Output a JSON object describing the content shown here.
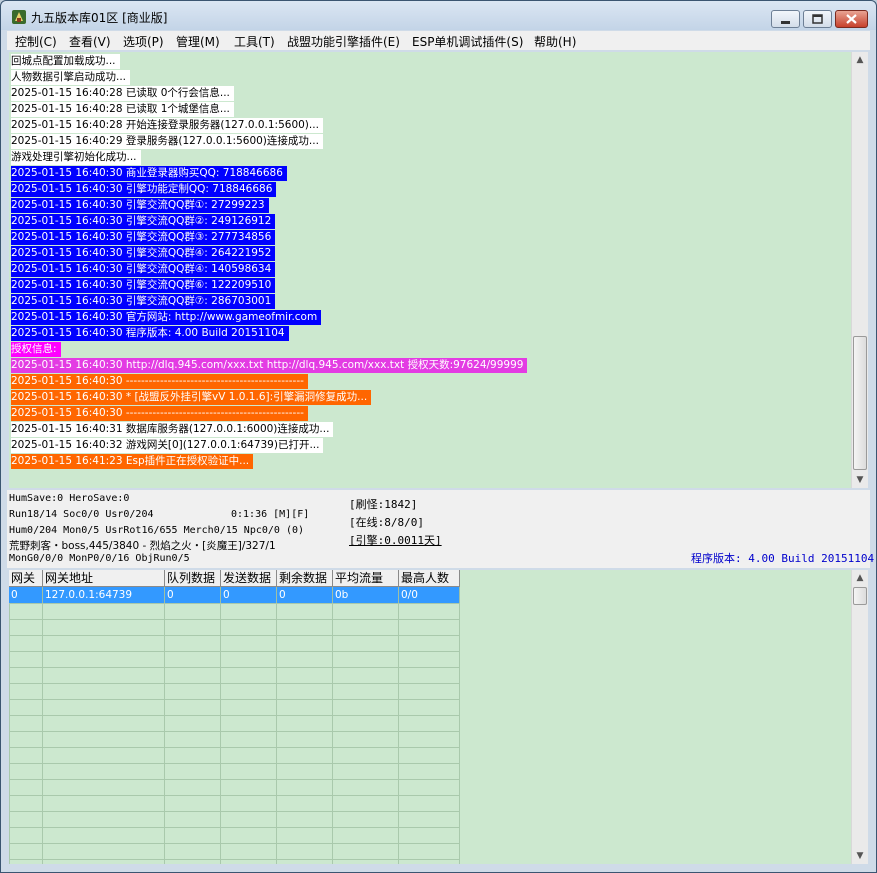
{
  "window": {
    "title": "九五版本库01区 [商业版]"
  },
  "menu": [
    "控制(C)",
    "查看(V)",
    "选项(P)",
    "管理(M)",
    "工具(T)",
    "战盟功能引擎插件(E)",
    "ESP单机调试插件(S)",
    "帮助(H)"
  ],
  "log": [
    {
      "text": "回城点配置加载成功...",
      "style": "plain"
    },
    {
      "text": "人物数据引擎启动成功...",
      "style": "plain"
    },
    {
      "text": "2025-01-15 16:40:28 已读取 0个行会信息...",
      "style": "plain"
    },
    {
      "text": "2025-01-15 16:40:28 已读取 1个城堡信息...",
      "style": "plain"
    },
    {
      "text": "2025-01-15 16:40:28 开始连接登录服务器(127.0.0.1:5600)...",
      "style": "plain"
    },
    {
      "text": "2025-01-15 16:40:29 登录服务器(127.0.0.1:5600)连接成功...",
      "style": "plain"
    },
    {
      "text": "游戏处理引擎初始化成功...",
      "style": "plain"
    },
    {
      "text": "2025-01-15 16:40:30 商业登录器购买QQ: 718846686",
      "style": "blue"
    },
    {
      "text": "2025-01-15 16:40:30 引擎功能定制QQ: 718846686",
      "style": "blue"
    },
    {
      "text": "2025-01-15 16:40:30 引擎交流QQ群①: 27299223",
      "style": "blue"
    },
    {
      "text": "2025-01-15 16:40:30 引擎交流QQ群②: 249126912",
      "style": "blue"
    },
    {
      "text": "2025-01-15 16:40:30 引擎交流QQ群③: 277734856",
      "style": "blue"
    },
    {
      "text": "2025-01-15 16:40:30 引擎交流QQ群④: 264221952",
      "style": "blue"
    },
    {
      "text": "2025-01-15 16:40:30 引擎交流QQ群④: 140598634",
      "style": "blue"
    },
    {
      "text": "2025-01-15 16:40:30 引擎交流QQ群⑥: 122209510",
      "style": "blue"
    },
    {
      "text": "2025-01-15 16:40:30 引擎交流QQ群⑦: 286703001",
      "style": "blue"
    },
    {
      "text": "2025-01-15 16:40:30 官方网站: http://www.gameofmir.com",
      "style": "blue"
    },
    {
      "text": "2025-01-15 16:40:30 程序版本: 4.00 Build 20151104",
      "style": "blue"
    },
    {
      "text": "授权信息:",
      "style": "magenta"
    },
    {
      "text": "2025-01-15 16:40:30 http://dlq.945.com/xxx.txt http://dlq.945.com/xxx.txt 授权天数:97624/99999",
      "style": "magenta-dim"
    },
    {
      "text": "2025-01-15 16:40:30 -----------------------------------------------",
      "style": "orange"
    },
    {
      "text": "2025-01-15 16:40:30 * [战盟反外挂引擎vV 1.0.1.6]:引擎漏洞修复成功...",
      "style": "orange"
    },
    {
      "text": "2025-01-15 16:40:30 -----------------------------------------------",
      "style": "orange"
    },
    {
      "text": "2025-01-15 16:40:31 数据库服务器(127.0.0.1:6000)连接成功...",
      "style": "plain"
    },
    {
      "text": "2025-01-15 16:40:32 游戏网关[0](127.0.0.1:64739)已打开...",
      "style": "plain"
    },
    {
      "text": "2025-01-15 16:41:23 Esp插件正在授权验证中...",
      "style": "orange"
    }
  ],
  "status": {
    "line1": "HumSave:0 HeroSave:0",
    "line2": "Run18/14 Soc0/0 Usr0/204",
    "time": "0:1:36 [M][F]",
    "line3": "Hum0/204 Mon0/5 UsrRot16/655 Merch0/15 Npc0/0 (0)",
    "line4": "荒野刺客・boss,445/3840 - 烈焰之火・[炎魔王]/327/1",
    "line5": "MonG0/0/0 MonP0/0/16 ObjRun0/5",
    "refresh": "[刷怪:1842]",
    "online": "[在线:8/8/0]",
    "engine": "[引擎:0.0011天]",
    "version": "程序版本: 4.00 Build 20151104"
  },
  "table": {
    "columns": [
      "网关",
      "网关地址",
      "队列数据",
      "发送数据",
      "剩余数据",
      "平均流量",
      "最高人数"
    ],
    "rows": [
      [
        "0",
        "127.0.0.1:64739",
        "0",
        "0",
        "0",
        "0b",
        "0/0"
      ]
    ]
  },
  "colors": {
    "log_bg": "#cce8cf",
    "blue": "#0000ff",
    "magenta": "#ff00ff",
    "magenta_dim": "#e33ce3",
    "orange": "#ff6600",
    "selection": "#3399ff",
    "version_text": "#0000cc"
  },
  "icons": [
    "app-icon",
    "minimize-icon",
    "maximize-icon",
    "close-icon",
    "scroll-up-icon",
    "scroll-down-icon"
  ]
}
